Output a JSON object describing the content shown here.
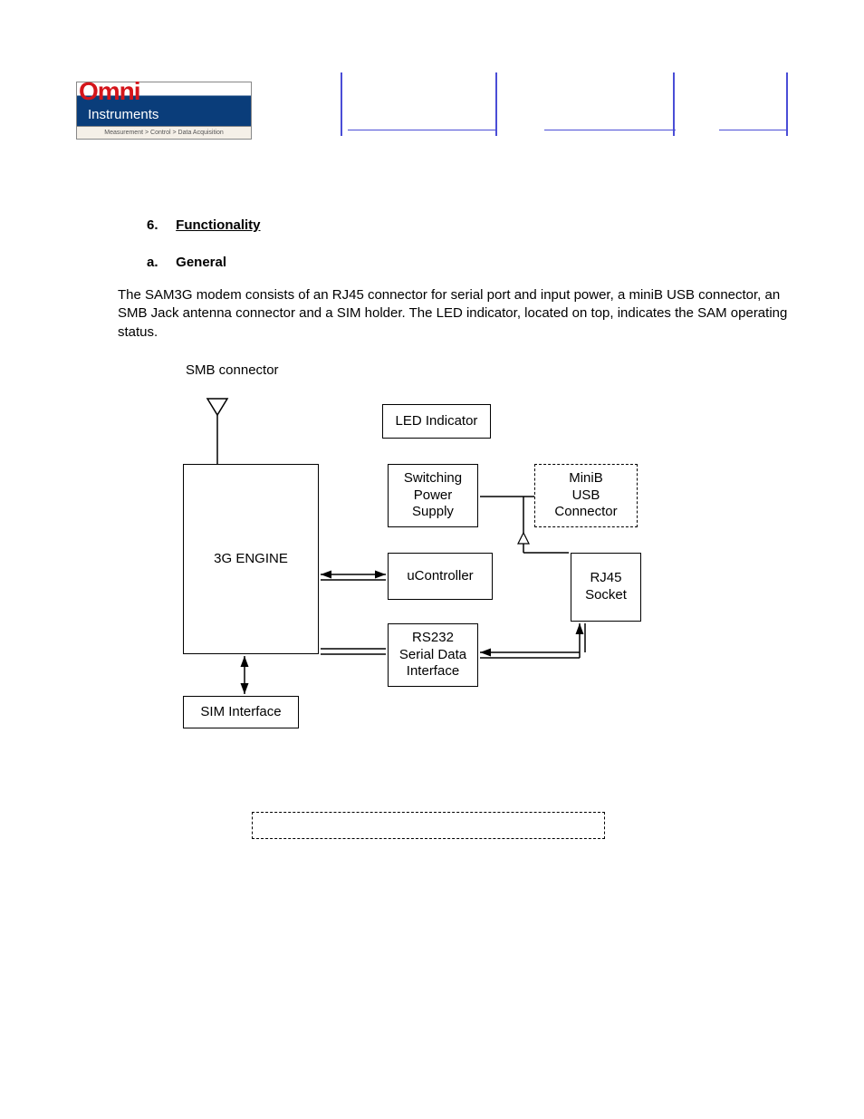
{
  "logo": {
    "brand_top": "Omni",
    "brand_bottom": "Instruments",
    "tagline": "Measurement > Control > Data Acquisition"
  },
  "section": {
    "number": "6.",
    "title": "Functionality"
  },
  "subsection": {
    "letter": "a.",
    "title": "General"
  },
  "paragraph": "The SAM3G modem consists of an RJ45 connector for serial port and input power, a miniB USB connector, an SMB Jack antenna connector and a SIM holder. The LED indicator, located on top, indicates the SAM operating status.",
  "diagram": {
    "smb_label": "SMB connector",
    "engine": "3G ENGINE",
    "led": "LED Indicator",
    "power": "Switching Power Supply",
    "usb": "MiniB USB Connector",
    "ucontroller": "uController",
    "rj45": "RJ45 Socket",
    "rs232": "RS232 Serial Data Interface",
    "sim": "SIM Interface"
  }
}
